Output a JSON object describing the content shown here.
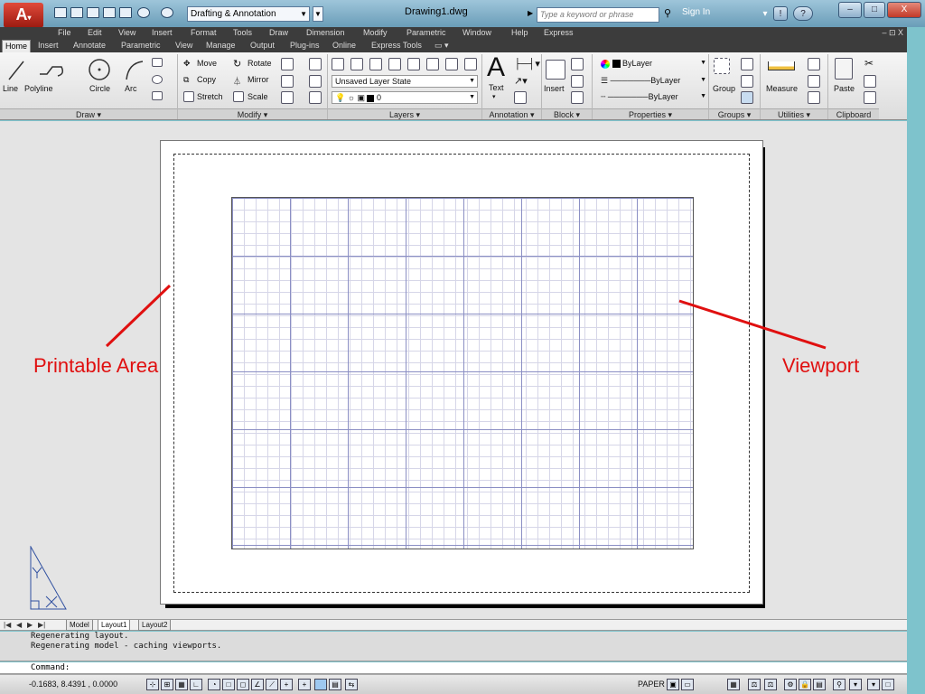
{
  "titlebar": {
    "workspace": "Drafting & Annotation",
    "document_title": "Drawing1.dwg",
    "search_placeholder": "Type a keyword or phrase",
    "sign_in": "Sign In",
    "window_controls": [
      "–",
      "□",
      "X"
    ]
  },
  "menubar": {
    "items": [
      "File",
      "Edit",
      "View",
      "Insert",
      "Format",
      "Tools",
      "Draw",
      "Dimension",
      "Modify",
      "Parametric",
      "Window",
      "Help",
      "Express"
    ],
    "mdi_controls": "– ⊡ X"
  },
  "ribbon_tabs": [
    "Home",
    "Insert",
    "Annotate",
    "Parametric",
    "View",
    "Manage",
    "Output",
    "Plug-ins",
    "Online",
    "Express Tools"
  ],
  "ribbon_tabs_active": "Home",
  "ribbon": {
    "draw": {
      "title": "Draw ▾",
      "tools": [
        "Line",
        "Polyline",
        "Circle",
        "Arc"
      ]
    },
    "modify": {
      "title": "Modify ▾",
      "tools": [
        "Move",
        "Rotate",
        "Copy",
        "Mirror",
        "Stretch",
        "Scale"
      ]
    },
    "layers": {
      "title": "Layers ▾",
      "layer_state": "Unsaved Layer State",
      "current_layer": "0"
    },
    "annotation": {
      "title": "Annotation ▾",
      "text_label": "Text"
    },
    "block": {
      "title": "Block ▾",
      "insert_label": "Insert"
    },
    "properties": {
      "title": "Properties ▾",
      "color": "ByLayer",
      "linetype": "ByLayer",
      "lineweight": "ByLayer"
    },
    "groups": {
      "title": "Groups ▾",
      "group_label": "Group"
    },
    "utilities": {
      "title": "Utilities ▾",
      "measure_label": "Measure"
    },
    "clipboard": {
      "title": "Clipboard",
      "paste_label": "Paste"
    }
  },
  "annotations": {
    "left": "Printable Area",
    "right": "Viewport"
  },
  "layout_tabs": [
    "Model",
    "Layout1",
    "Layout2"
  ],
  "layout_tabs_active": "Layout1",
  "command_history": [
    "Regenerating layout.",
    "Regenerating model - caching viewports."
  ],
  "command_prompt": "Command:",
  "status": {
    "coordinates": "-0.1683, 8.4391 , 0.0000",
    "space": "PAPER"
  },
  "colors": {
    "accent_red": "#e01010",
    "title_bar": "#7ea9c4",
    "ribbon_bg": "#ececec",
    "canvas_bg": "#e4e4e4"
  }
}
